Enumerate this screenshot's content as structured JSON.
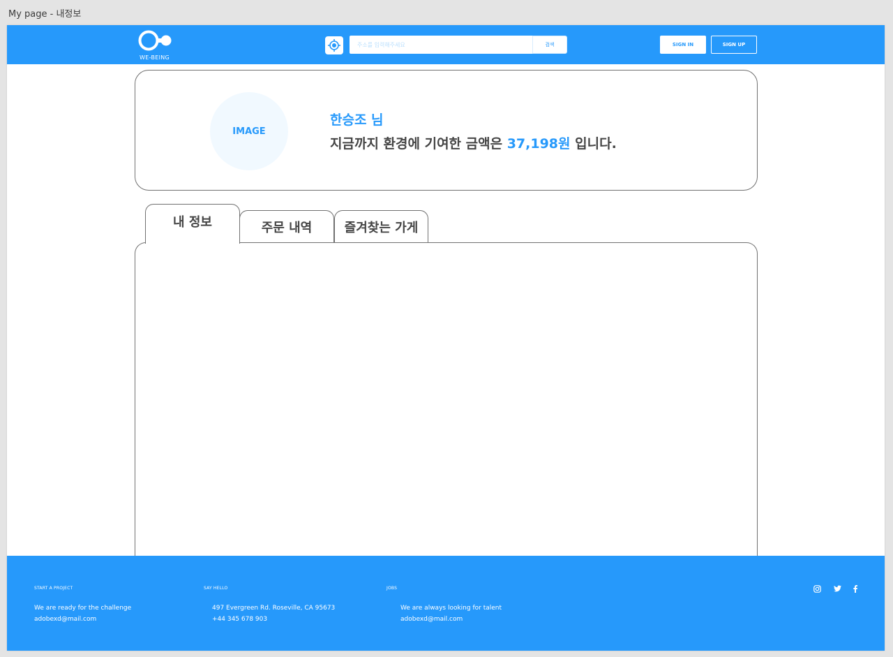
{
  "frame_title": "My page - 내정보",
  "header": {
    "logo_text": "WE-BEING",
    "search_placeholder": "주소를 입력해주세요",
    "search_button": "검색",
    "signin_label": "SIGN IN",
    "signup_label": "SIGN UP"
  },
  "profile": {
    "avatar_label": "IMAGE",
    "name": "한승조 님",
    "contrib_prefix": "지금까지 환경에 기여한 금액은 ",
    "contrib_amount": "37,198원",
    "contrib_suffix": " 입니다."
  },
  "tabs": [
    {
      "label": "내 정보",
      "active": true
    },
    {
      "label": "주문 내역",
      "active": false
    },
    {
      "label": "즐겨찾는 가게",
      "active": false
    }
  ],
  "footer": {
    "col1": {
      "heading": "START A PROJECT",
      "line1": "We are ready for the challenge",
      "line2": "adobexd@mail.com"
    },
    "col2": {
      "heading": "SAY HELLO",
      "line1": "497 Evergreen Rd. Roseville, CA 95673",
      "line2": "+44 345 678 903"
    },
    "col3": {
      "heading": "JOBS",
      "line1": "We are always looking for talent",
      "line2": "adobexd@mail.com"
    },
    "social_icons": [
      "instagram-icon",
      "twitter-icon",
      "facebook-icon"
    ]
  },
  "colors": {
    "brand": "#2699fb",
    "light_blue": "#bce0fd",
    "avatar_bg": "#f1f9ff",
    "text_dark": "#444444"
  }
}
